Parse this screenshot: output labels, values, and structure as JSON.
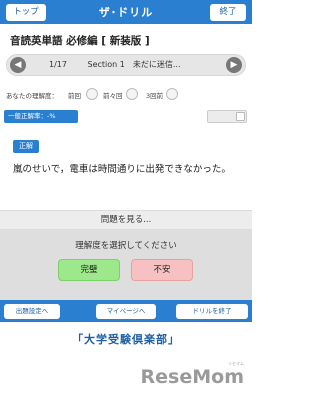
{
  "header": {
    "top_button": "トップ",
    "title": "ザ･ドリル",
    "end_button": "終了"
  },
  "book": {
    "title": "音読英単語 必修編 [ 新装版 ]"
  },
  "nav": {
    "prev_icon": "chevron-left-icon",
    "next_icon": "chevron-right-icon",
    "position": "1/17",
    "section_text": "Section 1　未だに迷信..."
  },
  "understanding": {
    "label": "あなたの理解度：",
    "previous": "前回",
    "before_previous": "前々回",
    "three_before": "3回前"
  },
  "stats": {
    "overall_rate": "一般正解率：-%"
  },
  "answer": {
    "correct_label": "正解",
    "sentence": "嵐のせいで，電車は時間通りに出発できなかった。"
  },
  "problem": {
    "show_label": "問題を見る..."
  },
  "selection": {
    "prompt": "理解度を選択してください",
    "done_button": "完璧",
    "anxious_button": "不安"
  },
  "footer": {
    "settings_button": "出題設定へ",
    "mypage_button": "マイページへ",
    "end_drill_button": "ドリルを終了"
  },
  "branding": {
    "club_name": "「大学受験倶楽部」",
    "watermark": "ReseMom",
    "watermark_sub": "リセマム"
  },
  "colors": {
    "primary": "#2a7fd0",
    "done": "#9ce88a",
    "anxious": "#f8c1c1"
  }
}
